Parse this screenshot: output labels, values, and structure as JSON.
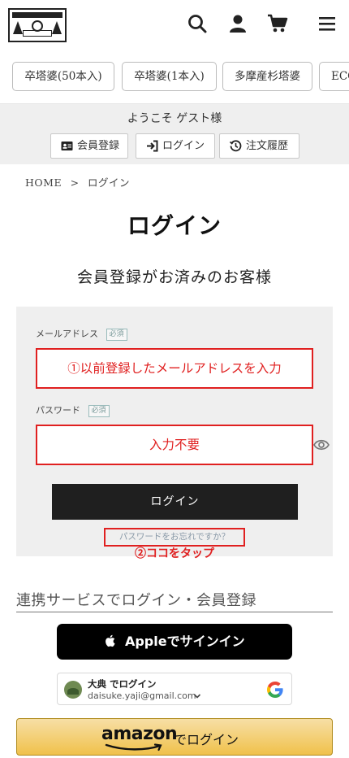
{
  "header": {
    "logo_name": "logo",
    "icons": [
      "search-icon",
      "user-icon",
      "cart-icon",
      "menu-icon"
    ]
  },
  "categories": [
    "卒塔婆(50本入)",
    "卒塔婆(1本入)",
    "多摩産杉塔婆",
    "ECO"
  ],
  "welcome": {
    "text": "ようこそ ゲスト様",
    "register_label": "会員登録",
    "login_label": "ログイン",
    "history_label": "注文履歴"
  },
  "breadcrumb": {
    "home": "HOME",
    "separator": ">",
    "current": "ログイン"
  },
  "page_title": "ログイン",
  "section_title": "会員登録がお済みのお客様",
  "form": {
    "email_label": "メールアドレス",
    "required_badge": "必須",
    "email_annotation": "①以前登録したメールアドレスを入力",
    "password_label": "パスワード",
    "password_annotation": "入力不要",
    "login_button": "ログイン",
    "forgot_link": "パスワードをお忘れですか？",
    "tap_note": "②ココをタップ"
  },
  "sns": {
    "title": "連携サービスでログイン・会員登録",
    "apple_label": "Appleでサインイン",
    "google_name": "大典 でログイン",
    "google_email": "daisuke.yaji@gmail.com",
    "amazon_word": "amazon",
    "amazon_suffix": "でログイン"
  },
  "colors": {
    "annotation_red": "#e02020",
    "panel_bg": "#efefef",
    "login_button_bg": "#1f1f1f",
    "amazon_gold": "#f0c14b"
  }
}
